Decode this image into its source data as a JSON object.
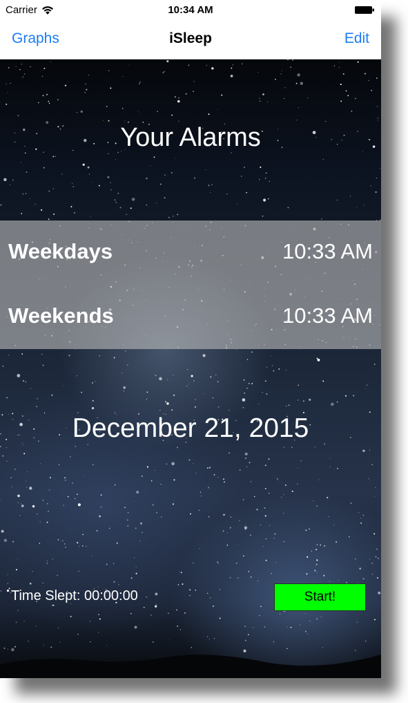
{
  "status_bar": {
    "carrier": "Carrier",
    "time": "10:34 AM",
    "icons": [
      "wifi-icon",
      "battery-icon"
    ]
  },
  "nav": {
    "left_label": "Graphs",
    "title": "iSleep",
    "right_label": "Edit",
    "link_color": "#1a7cf2"
  },
  "main": {
    "section_title": "Your Alarms",
    "alarms": [
      {
        "name": "Weekdays",
        "time": "10:33 AM"
      },
      {
        "name": "Weekends",
        "time": "10:33 AM"
      }
    ],
    "date": "December 21, 2015",
    "time_slept": "Time Slept: 00:00:00",
    "start_label": "Start!",
    "start_color": "#00ff00",
    "background": "night-sky-image"
  }
}
